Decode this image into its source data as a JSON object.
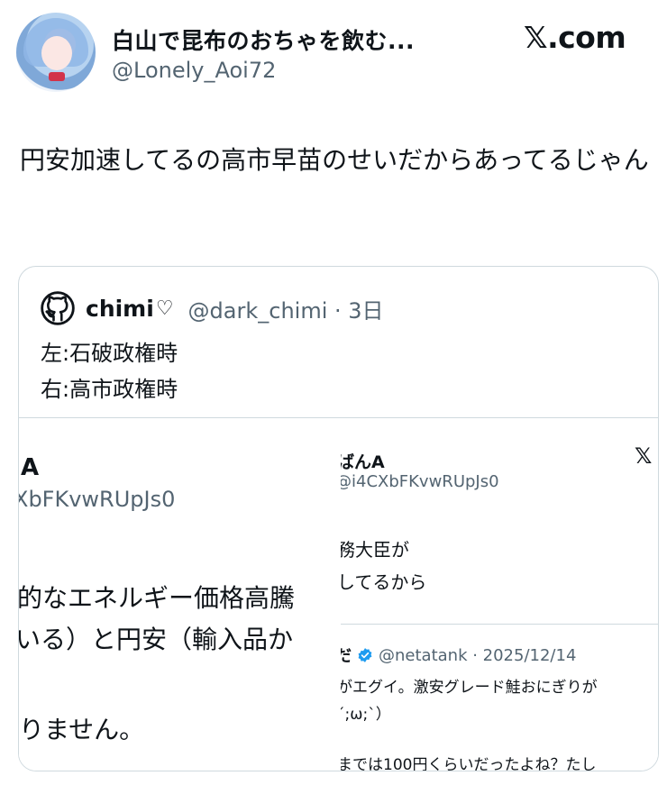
{
  "header": {
    "display_name": "白山で昆布のおちゃを飲む...",
    "handle": "@Lonely_Aoi72",
    "site_label": "𝕏.com"
  },
  "tweet": {
    "text": "円安加速してるの高市早苗のせいだからあってるじゃん"
  },
  "quote": {
    "name": "chimi",
    "heart": "♡",
    "handle_time": "@dark_chimi · 3日",
    "lines": [
      "左:石破政権時",
      "右:高市政権時"
    ],
    "image_left": {
      "name": "A",
      "handle": "XbFKvwRUpJs0",
      "line1": "的なエネルギー価格高騰",
      "line2": "いる）と円安（輸入品か",
      "line3": "りません。"
    },
    "image_right": {
      "name": "ばんA",
      "handle": "@i4CXbFKvwRUpJs0",
      "x_logo": "𝕏",
      "line1": "務大臣が",
      "line2": "してるから",
      "sub": {
        "name": "だ",
        "handle_time": "@netatank · 2025/12/14",
        "line1": "がエグイ。激安グレード鮭おにぎりが",
        "line2": "´;ω;`）",
        "line3": "までは100円くらいだったよね？たし"
      }
    }
  }
}
